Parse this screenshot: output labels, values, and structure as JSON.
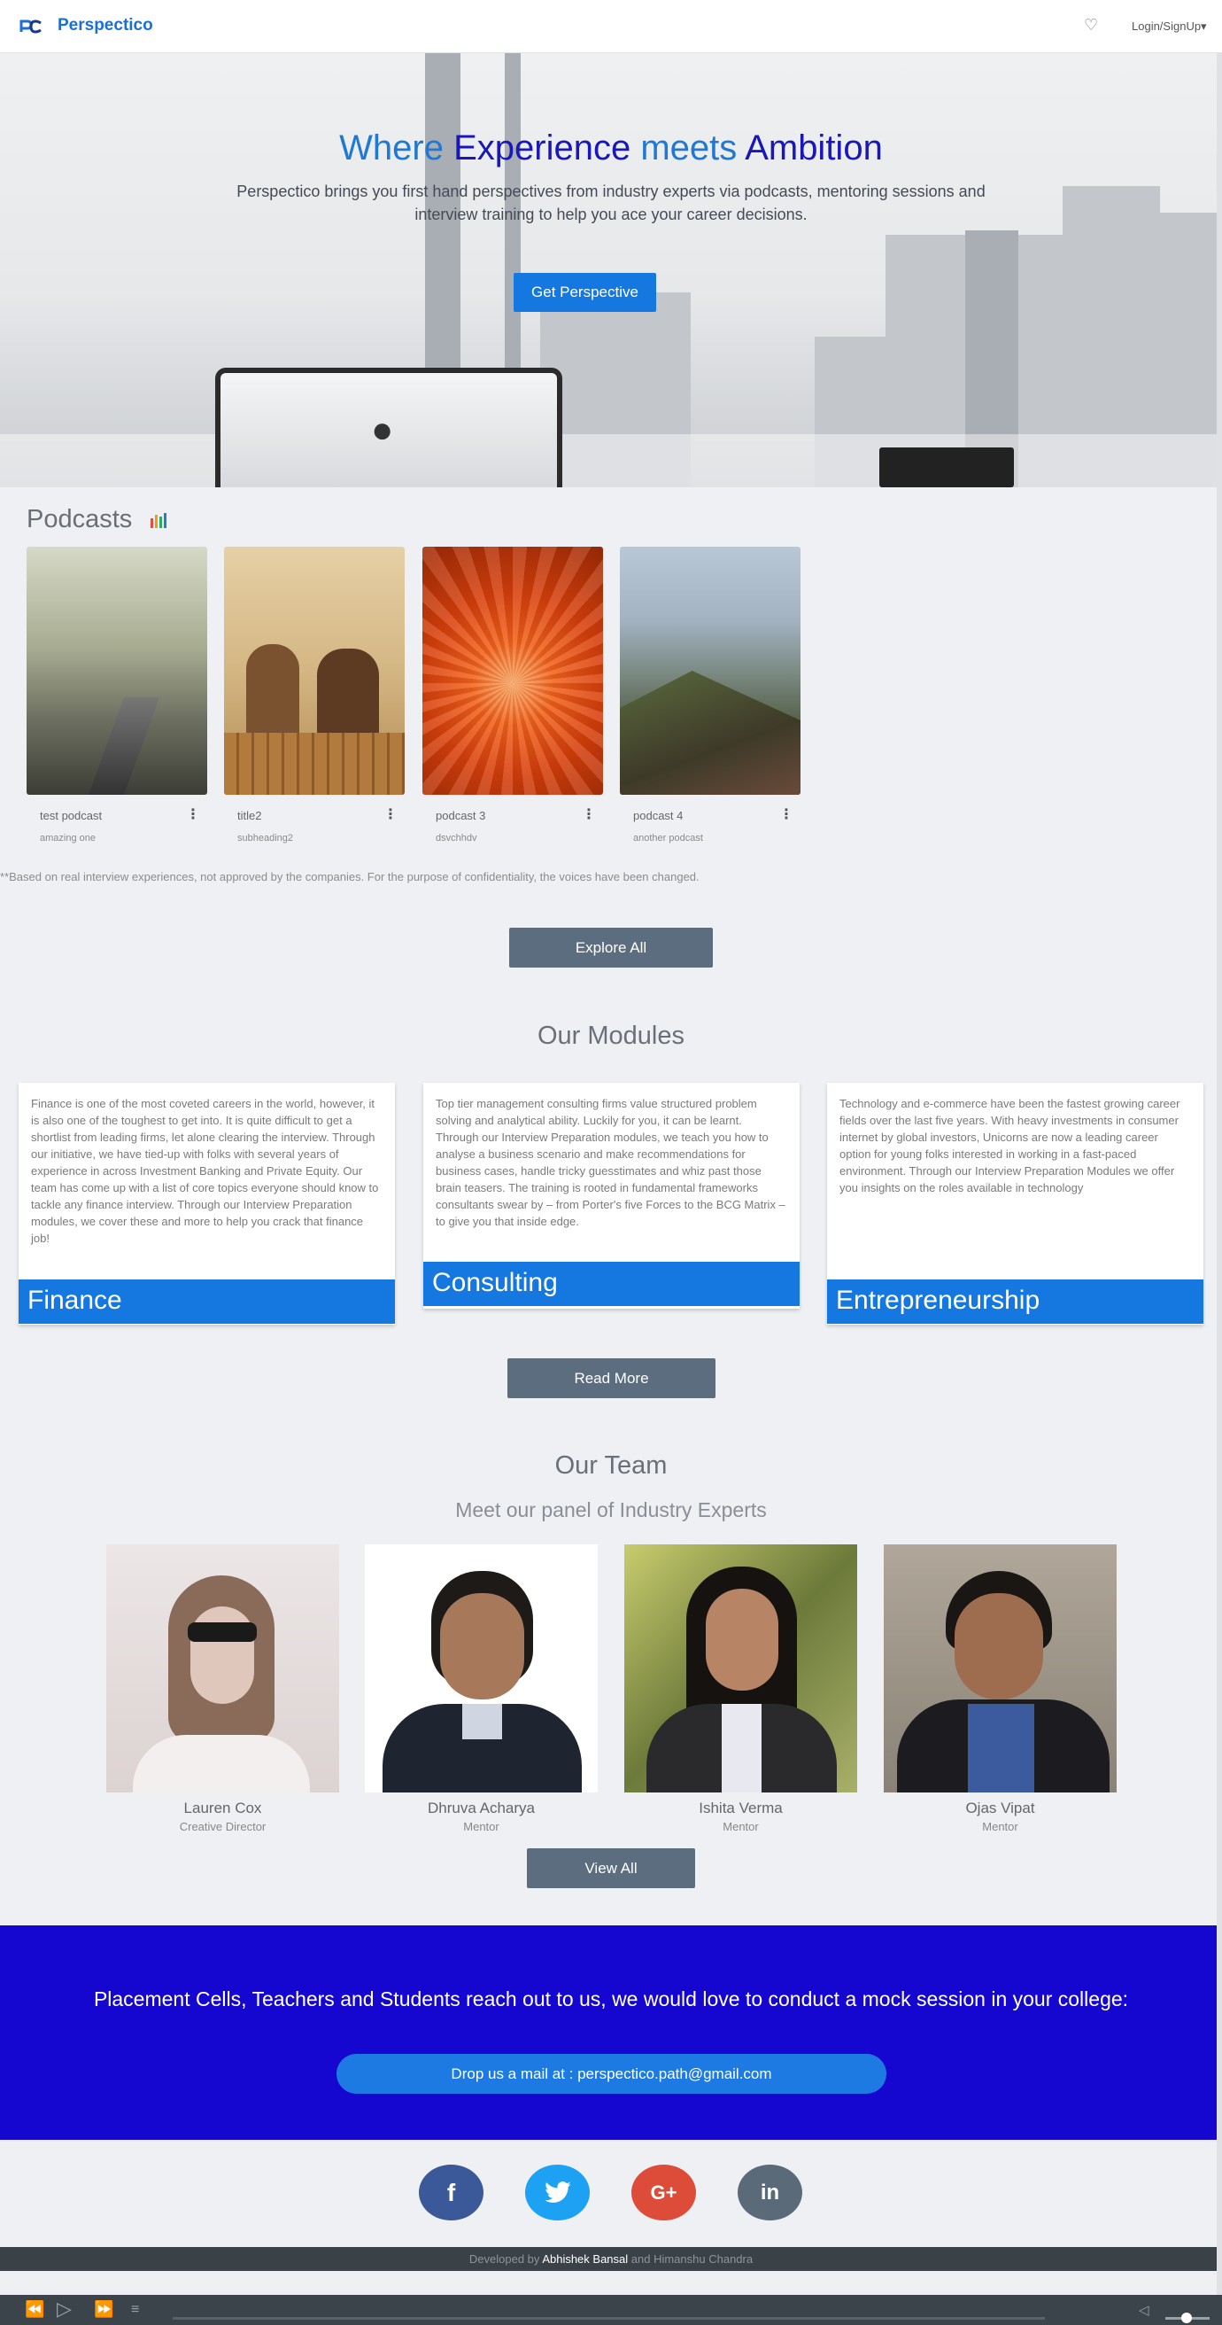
{
  "nav": {
    "brand": "Perspectico",
    "heart_icon": "heart-icon",
    "login_label": "Login/SignUp▾"
  },
  "hero": {
    "title_parts": [
      "Where ",
      "Experience",
      " meets ",
      "Ambition"
    ],
    "subtitle": "Perspectico brings you first hand perspectives from industry experts via podcasts, mentoring sessions and interview training to help you ace your career decisions.",
    "button_label": "Get Perspective"
  },
  "podcasts": {
    "title": "Podcasts",
    "items": [
      {
        "title": "test podcast",
        "subtitle": "amazing one"
      },
      {
        "title": "title2",
        "subtitle": "subheading2"
      },
      {
        "title": "podcast 3",
        "subtitle": "dsvchhdv"
      },
      {
        "title": "podcast 4",
        "subtitle": "another podcast"
      }
    ],
    "menu_glyph": "⋮",
    "disclaimer": "**Based on real interview experiences, not approved by the companies. For the purpose of confidentiality, the voices have been changed.",
    "explore_label": "Explore All"
  },
  "modules": {
    "title": "Our Modules",
    "items": [
      {
        "name": "Finance",
        "text": "Finance is one of the most coveted careers in the world, however, it is also one of the toughest to get into. It is quite difficult to get a shortlist from leading firms, let alone clearing the interview. Through our initiative, we have tied-up with folks with several years of experience in across Investment Banking and Private Equity. Our team has come up with a list of core topics everyone should know to tackle any finance interview. Through our Interview Preparation modules, we cover these and more to help you crack that finance job!"
      },
      {
        "name": "Consulting",
        "text": "Top tier management consulting firms value structured problem solving and analytical ability. Luckily for you, it can be learnt. Through our Interview Preparation modules, we teach you how to analyse a business scenario and make recommendations for business cases, handle tricky guesstimates and whiz past those brain teasers. The training is rooted in fundamental frameworks consultants swear by – from Porter's five Forces to the BCG Matrix – to give you that inside edge."
      },
      {
        "name": "Entrepreneurship",
        "text": "Technology and e-commerce have been the fastest growing career fields over the last five years. With heavy investments in consumer internet by global investors, Unicorns are now a leading career option for young folks interested in working in a fast-paced environment. Through our Interview Preparation Modules we offer you insights on the roles available in technology"
      }
    ],
    "read_more_label": "Read More"
  },
  "team": {
    "title": "Our Team",
    "subtitle": "Meet our panel of Industry Experts",
    "members": [
      {
        "name": "Lauren Cox",
        "role": "Creative Director"
      },
      {
        "name": "Dhruva Acharya",
        "role": "Mentor"
      },
      {
        "name": "Ishita Verma",
        "role": "Mentor"
      },
      {
        "name": "Ojas Vipat",
        "role": "Mentor"
      }
    ],
    "view_all_label": "View All"
  },
  "cta": {
    "text": "Placement Cells, Teachers and Students reach out to us, we would love to conduct a mock session in your college:",
    "button_label": "Drop us a mail at : perspectico.path@gmail.com"
  },
  "social": [
    {
      "icon": "facebook-icon",
      "glyph": "f",
      "color": "#3b5998"
    },
    {
      "icon": "twitter-icon",
      "glyph": "🐦",
      "color": "#1da1f2"
    },
    {
      "icon": "google-plus-icon",
      "glyph": "G+",
      "color": "#dd4b39"
    },
    {
      "icon": "linkedin-icon",
      "glyph": "in",
      "color": "#5b6a78"
    }
  ],
  "footer": {
    "prefix": "Developed by ",
    "dev1": "Abhishek Bansal",
    "and": " and ",
    "dev2": "Himanshu Chandra"
  },
  "colors": {
    "brand": "#1a6fd8",
    "primary_button": "#1577e0",
    "dark_button": "#5c6d80",
    "cta_background": "#1507cf"
  }
}
